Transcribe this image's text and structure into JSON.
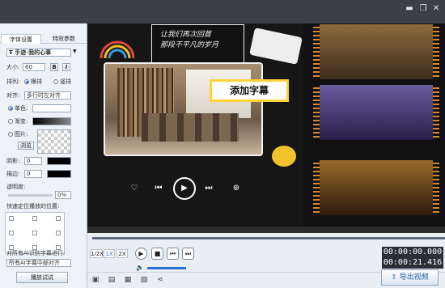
{
  "tabs": [
    "字体设置",
    "特效参数"
  ],
  "font": {
    "name": "手迹-我的心事",
    "label_size": "大小:",
    "size": "60",
    "bold": "B",
    "italic": "I"
  },
  "arrange": {
    "label": "排列:",
    "options": [
      "横排",
      "竖排"
    ],
    "selected": "横排"
  },
  "align": {
    "label": "对齐:",
    "value": "多行时左对齐"
  },
  "fill": {
    "solid": "单色:",
    "gradient": "渐变:",
    "image": "图片:",
    "browse": "浏览",
    "selected": "单色",
    "solid_color": "#ffffff"
  },
  "shadow": {
    "label": "阴影:",
    "value": "0"
  },
  "stroke": {
    "label": "描边:",
    "value": "0"
  },
  "opacity": {
    "label": "透明度:",
    "value": "0%"
  },
  "position": {
    "label": "快速定位播放的位置:"
  },
  "ai_align": {
    "label": "对所有AI识别字幕进行:",
    "value": "所有AI字幕中部对齐"
  },
  "play_test": "播放试试",
  "preview": {
    "speech_text": "让我们再次回首\n那段不平凡的岁月",
    "caption": "添加字幕"
  },
  "player": {
    "speeds": [
      "1/2X",
      "1X",
      "2X"
    ],
    "active_speed": "1X"
  },
  "times": {
    "current": "00:00:00.000",
    "total": "00:00:21.416"
  },
  "export_label": "导出视频",
  "colors": {
    "accent": "#2a6fd6",
    "caption_bg": "#ffd23a",
    "timeline": "#2d2d2d"
  }
}
